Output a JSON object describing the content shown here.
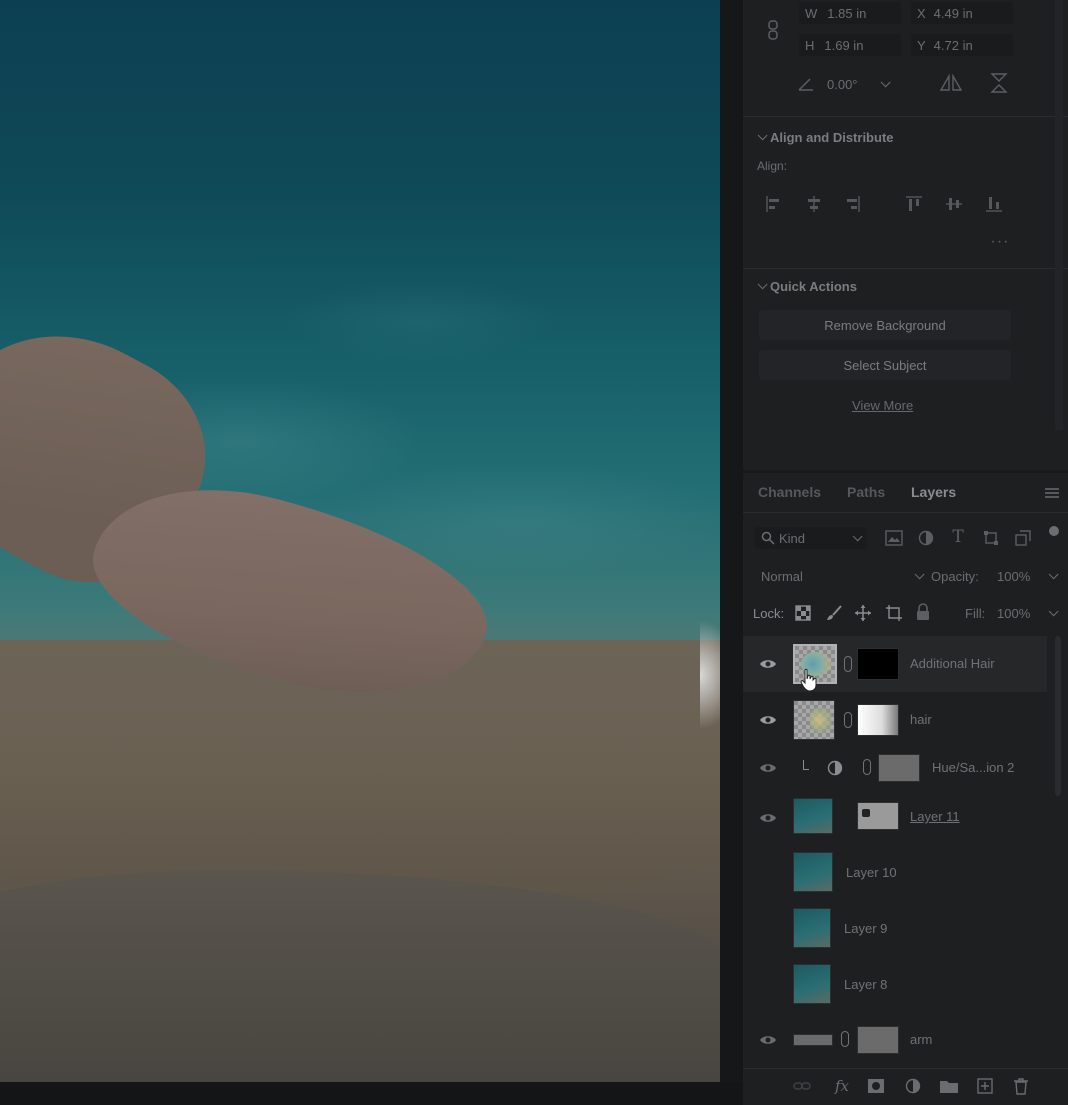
{
  "properties": {
    "w_label": "W",
    "w_value": "1.85 in",
    "h_label": "H",
    "h_value": "1.69 in",
    "x_label": "X",
    "x_value": "4.49 in",
    "y_label": "Y",
    "y_value": "4.72 in",
    "angle_value": "0.00°"
  },
  "align": {
    "title": "Align and Distribute",
    "subtitle": "Align:"
  },
  "quick_actions": {
    "title": "Quick Actions",
    "remove_bg": "Remove Background",
    "select_subject": "Select Subject",
    "view_more": "View More"
  },
  "tabs": {
    "channels": "Channels",
    "paths": "Paths",
    "layers": "Layers"
  },
  "filter": {
    "kind": "Kind"
  },
  "blend": {
    "mode": "Normal",
    "opacity_label": "Opacity:",
    "opacity_value": "100%",
    "lock_label": "Lock:",
    "fill_label": "Fill:",
    "fill_value": "100%"
  },
  "layers": [
    {
      "name": "Additional Hair"
    },
    {
      "name": "hair"
    },
    {
      "name": "Hue/Sa...ion 2"
    },
    {
      "name": "Layer 11"
    },
    {
      "name": "Layer 10"
    },
    {
      "name": "Layer 9"
    },
    {
      "name": "Layer 8"
    },
    {
      "name": "arm"
    }
  ],
  "colors": {
    "panel_bg": "#1e1f21",
    "selected_row": "#262729",
    "text_dim": "#6b6d70"
  }
}
